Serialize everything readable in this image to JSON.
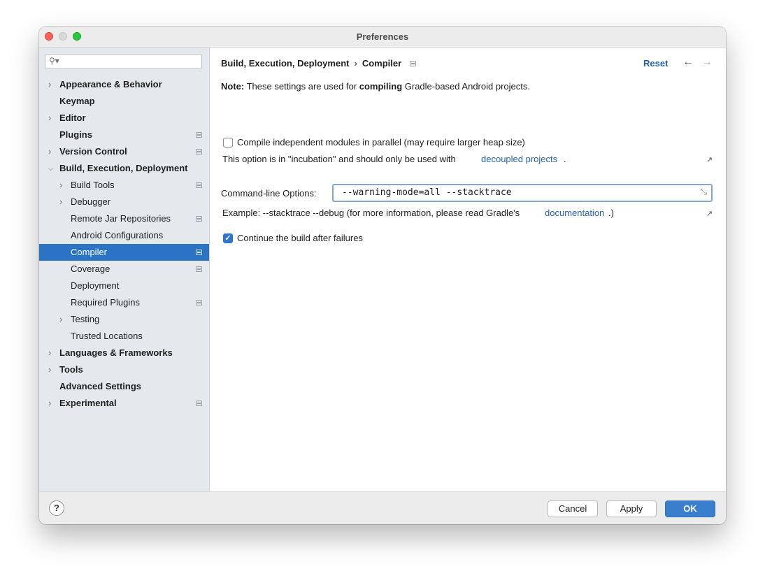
{
  "window": {
    "title": "Preferences"
  },
  "sidebar": {
    "search_placeholder": "",
    "items": [
      {
        "label": "Appearance & Behavior",
        "level": 0,
        "expandable": true,
        "expanded": false,
        "bold": true,
        "project_icon": false
      },
      {
        "label": "Keymap",
        "level": 0,
        "expandable": false,
        "bold": true,
        "project_icon": false
      },
      {
        "label": "Editor",
        "level": 0,
        "expandable": true,
        "expanded": false,
        "bold": true,
        "project_icon": false
      },
      {
        "label": "Plugins",
        "level": 0,
        "expandable": false,
        "bold": true,
        "project_icon": true
      },
      {
        "label": "Version Control",
        "level": 0,
        "expandable": true,
        "expanded": false,
        "bold": true,
        "project_icon": true
      },
      {
        "label": "Build, Execution, Deployment",
        "level": 0,
        "expandable": true,
        "expanded": true,
        "bold": true,
        "project_icon": false
      },
      {
        "label": "Build Tools",
        "level": 1,
        "expandable": true,
        "expanded": false,
        "bold": false,
        "project_icon": true
      },
      {
        "label": "Debugger",
        "level": 1,
        "expandable": true,
        "expanded": false,
        "bold": false,
        "project_icon": false
      },
      {
        "label": "Remote Jar Repositories",
        "level": 1,
        "expandable": false,
        "bold": false,
        "project_icon": true
      },
      {
        "label": "Android Configurations",
        "level": 1,
        "expandable": false,
        "bold": false,
        "project_icon": false
      },
      {
        "label": "Compiler",
        "level": 1,
        "expandable": false,
        "bold": false,
        "project_icon": true,
        "selected": true
      },
      {
        "label": "Coverage",
        "level": 1,
        "expandable": false,
        "bold": false,
        "project_icon": true
      },
      {
        "label": "Deployment",
        "level": 1,
        "expandable": false,
        "bold": false,
        "project_icon": false
      },
      {
        "label": "Required Plugins",
        "level": 1,
        "expandable": false,
        "bold": false,
        "project_icon": true
      },
      {
        "label": "Testing",
        "level": 1,
        "expandable": true,
        "expanded": false,
        "bold": false,
        "project_icon": false
      },
      {
        "label": "Trusted Locations",
        "level": 1,
        "expandable": false,
        "bold": false,
        "project_icon": false
      },
      {
        "label": "Languages & Frameworks",
        "level": 0,
        "expandable": true,
        "expanded": false,
        "bold": true,
        "project_icon": false
      },
      {
        "label": "Tools",
        "level": 0,
        "expandable": true,
        "expanded": false,
        "bold": true,
        "project_icon": false
      },
      {
        "label": "Advanced Settings",
        "level": 0,
        "expandable": false,
        "bold": true,
        "project_icon": false
      },
      {
        "label": "Experimental",
        "level": 0,
        "expandable": true,
        "expanded": false,
        "bold": true,
        "project_icon": true
      }
    ]
  },
  "header": {
    "breadcrumb_parent": "Build, Execution, Deployment",
    "breadcrumb_sep": "›",
    "breadcrumb_current": "Compiler",
    "reset_label": "Reset",
    "back_icon": "←",
    "forward_icon": "→"
  },
  "main": {
    "note_prefix": "Note:",
    "note_text_1": " These settings are used for ",
    "note_bold": "compiling",
    "note_text_2": " Gradle-based Android projects.",
    "parallel_label": "Compile independent modules in parallel (may require larger heap size)",
    "parallel_checked": false,
    "incubation_text": "This option is in \"incubation\" and should only be used with",
    "incubation_link": "decoupled projects",
    "incubation_suffix": ".",
    "cmd_label": "Command-line Options:",
    "cmd_value": "--warning-mode=all --stacktrace",
    "example_text": "Example: --stacktrace --debug (for more information, please read Gradle's",
    "example_link": "documentation",
    "example_suffix": ".)",
    "continue_label": "Continue the build after failures",
    "continue_checked": true
  },
  "footer": {
    "help_label": "?",
    "cancel_label": "Cancel",
    "apply_label": "Apply",
    "ok_label": "OK"
  },
  "colors": {
    "accent": "#2a73c5",
    "link": "#2463b2",
    "primary_button": "#3a7fce"
  }
}
